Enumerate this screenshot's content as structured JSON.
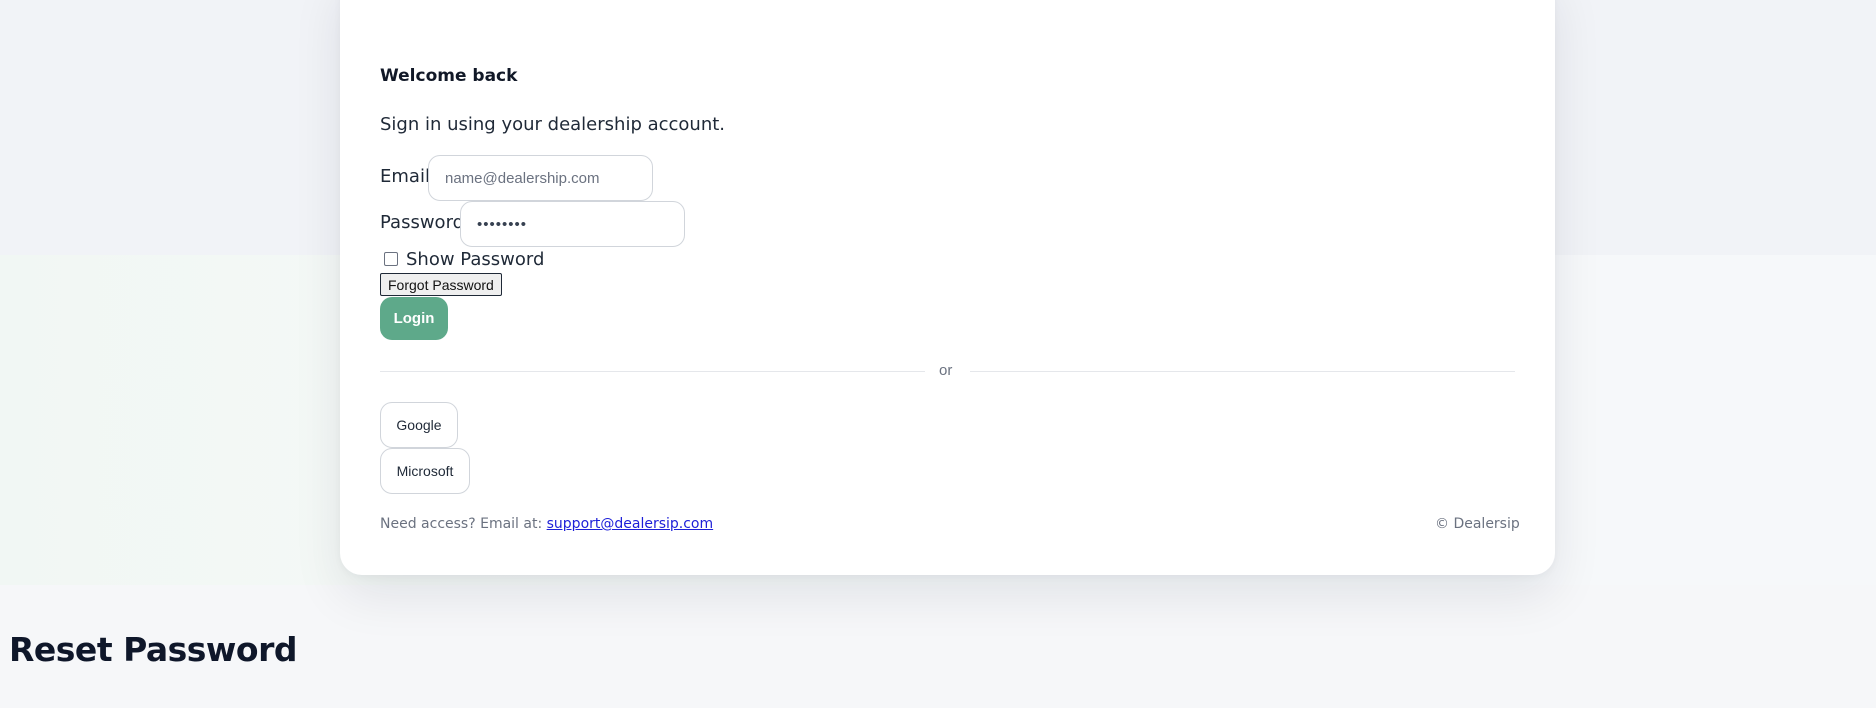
{
  "login": {
    "heading": "Welcome back",
    "subtitle": "Sign in using your dealership account.",
    "email_label": "Email",
    "email_placeholder": "name@dealership.com",
    "password_label": "Password",
    "password_value": "••••••••",
    "show_password_label": "Show Password",
    "show_password_checked": false,
    "forgot_password_label": "Forgot Password",
    "login_label": "Login",
    "divider_text": "or",
    "google_label": "Google",
    "microsoft_label": "Microsoft",
    "footer_prefix": "Need access? Email at: ",
    "footer_email": "support@dealersip.com",
    "copyright": "© Dealersip"
  },
  "reset": {
    "heading": "Reset Password"
  },
  "colors": {
    "accent": "#5ea98a",
    "link": "#1d1fd8"
  }
}
